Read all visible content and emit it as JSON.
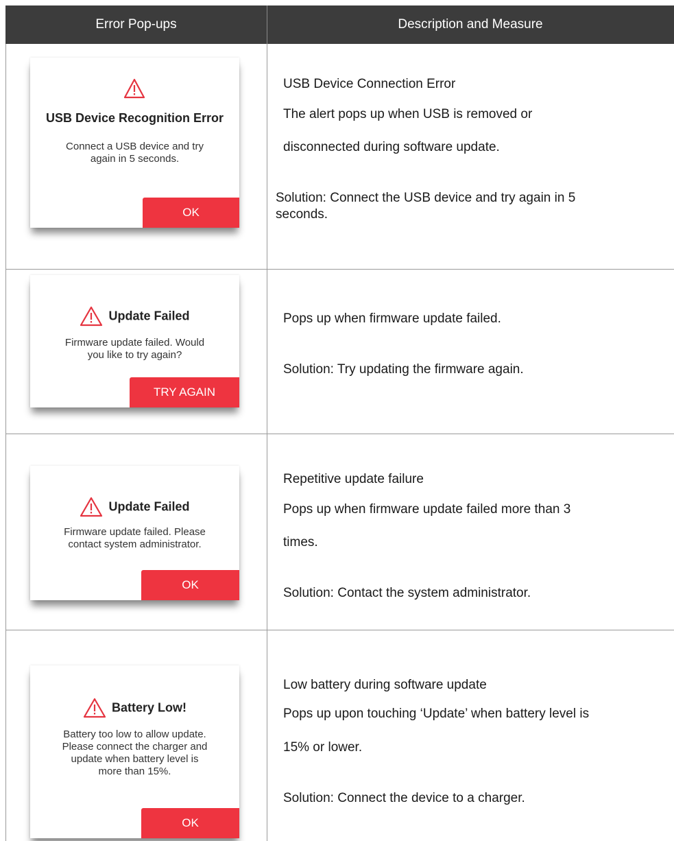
{
  "header": {
    "col1": "Error Pop-ups",
    "col2": "Description and Measure"
  },
  "rows": [
    {
      "popup": {
        "title": "USB Device Recognition Error",
        "message_lines": [
          "Connect a USB device and try",
          "again in 5 seconds."
        ],
        "button": "OK",
        "icon": "warning-triangle-icon"
      },
      "desc": {
        "lines": [
          "USB Device Connection Error",
          "The alert pops up when USB is removed or",
          "disconnected during software update."
        ],
        "solution_lines": [
          "Solution: Connect the USB device and try again in 5",
          "seconds."
        ]
      }
    },
    {
      "popup": {
        "title": "Update Failed",
        "message_lines": [
          "Firmware update failed. Would",
          "you like to try again?"
        ],
        "button": "TRY AGAIN",
        "icon": "warning-triangle-icon"
      },
      "desc": {
        "lines": [
          "Pops up when firmware update failed."
        ],
        "solution_lines": [
          "Solution: Try updating the firmware again."
        ]
      }
    },
    {
      "popup": {
        "title": "Update Failed",
        "message_lines": [
          "Firmware update failed. Please",
          "contact system administrator."
        ],
        "button": "OK",
        "icon": "warning-triangle-icon"
      },
      "desc": {
        "lines": [
          "Repetitive update failure",
          "Pops up when firmware update failed more than 3",
          "times."
        ],
        "solution_lines": [
          "Solution: Contact the system administrator."
        ]
      }
    },
    {
      "popup": {
        "title": "Battery Low!",
        "message_lines": [
          "Battery too low to allow update.",
          "Please connect the charger and",
          "update when battery level is",
          "more than 15%."
        ],
        "button": "OK",
        "icon": "warning-triangle-icon"
      },
      "desc": {
        "lines": [
          "Low battery during software update",
          "Pops up upon touching ‘Update’ when battery level is",
          "15% or lower."
        ],
        "solution_lines": [
          "Solution: Connect the device to a charger."
        ]
      }
    }
  ],
  "colors": {
    "header_bg": "#3c3c3c",
    "accent_red": "#ee3440",
    "grid": "#9a9a9a"
  }
}
